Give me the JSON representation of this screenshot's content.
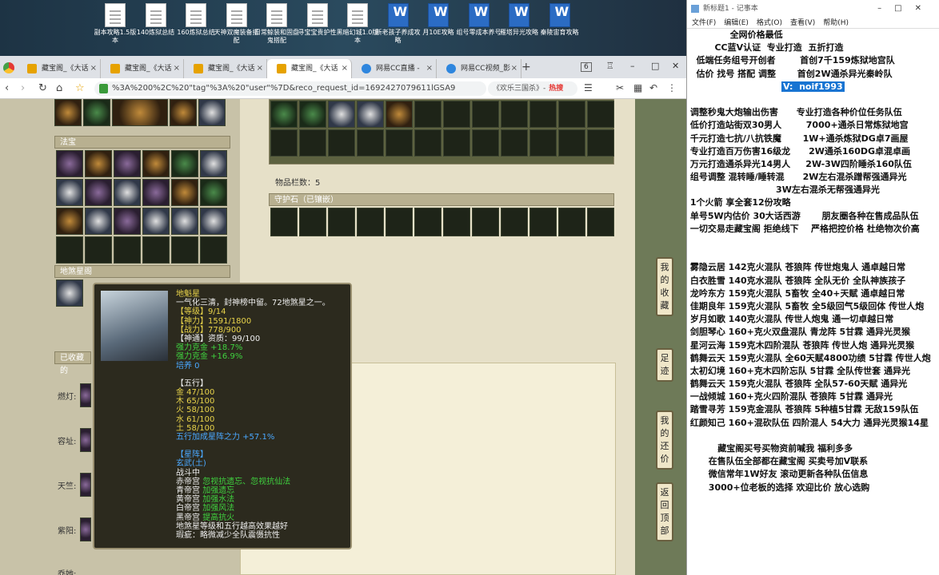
{
  "desktop": {
    "icons": [
      {
        "label": "副本攻略1.5版本",
        "type": "doc"
      },
      {
        "label": "140炼狱总结",
        "type": "doc"
      },
      {
        "label": "160炼狱总结",
        "type": "doc"
      },
      {
        "label": "天神双魔装备搭配",
        "type": "doc"
      },
      {
        "label": "日常鲸装和固盘鬼搭配",
        "type": "doc"
      },
      {
        "label": "寻宝宝贵护性",
        "type": "doc"
      },
      {
        "label": "黑暗幻城1.0版本",
        "type": "doc"
      },
      {
        "label": "新老孩子养成攻略",
        "type": "word"
      },
      {
        "label": "月10E攻略",
        "type": "word"
      },
      {
        "label": "组号零成本养号",
        "type": "word"
      },
      {
        "label": "雁塔异光攻略",
        "type": "word"
      },
      {
        "label": "秦陵宙育攻略",
        "type": "word"
      }
    ]
  },
  "browser": {
    "tabs": [
      {
        "label": "藏宝阁_《大话",
        "icon": "cbg"
      },
      {
        "label": "藏宝阁_《大话",
        "icon": "cbg"
      },
      {
        "label": "藏宝阁_《大话",
        "icon": "cbg"
      },
      {
        "label": "藏宝阁_《大话",
        "icon": "cbg",
        "active": true
      },
      {
        "label": "网易CC直播 -",
        "icon": "cc"
      },
      {
        "label": "网易CC视频_影",
        "icon": "cc"
      }
    ],
    "tab_count": "6",
    "url": "%3A%200%2C%20\"tag\"%3A%20\"user\"%7D&reco_request_id=1692427079611lGSA9",
    "search_text": "《欢乐三国杀》-",
    "search_hot": "热搜"
  },
  "page": {
    "section_fabao": "法宝",
    "section_disha": "地煞星阁",
    "section_collected": "已收藏的",
    "item_count": "物品栏数：5",
    "guardian_title": "守护石（已镶嵌）",
    "left_labels": [
      "燃灯:",
      "容址:",
      "天竺:",
      "紫阳:",
      "乔她:"
    ],
    "side_buttons": [
      {
        "label": "我的收藏"
      },
      {
        "label": "足迹"
      },
      {
        "label": "我的还价"
      },
      {
        "label": "返回顶部"
      }
    ]
  },
  "tooltip": {
    "name": "地魁星",
    "desc": "一气化三清，封神榜中留。72地煞星之一。",
    "level": "【等级】9/14",
    "power": "【神力】1591/1800",
    "battle": "【战力】778/900",
    "aptitude": "【神通】资质：99/100",
    "kezhi1": "强力克金 +18.7%",
    "kezhi2": "强力克金 +16.9%",
    "peiyang": "培养 0",
    "wuxing_title": "【五行】",
    "jin": "金 47/100",
    "mu": "木 65/100",
    "huo": "火 58/100",
    "shui": "水 61/100",
    "tu": "土 58/100",
    "wuxing_bonus": "五行加成星阵之力 +57.1%",
    "xingzhen_title": "【星阵】",
    "xingzhen_name": "玄武(土)",
    "status": "战斗中",
    "chidi_k": "赤帝宫",
    "chidi_v": "忽视抗遗忘、忽视抗仙法",
    "qingdi_k": "青帝宫",
    "qingdi_v": "加强遗忘",
    "huangdi_k": "黄帝宫",
    "huangdi_v": "加强水法",
    "baidi_k": "白帝宫",
    "baidi_v": "加强风法",
    "heidi_k": "黑帝宫",
    "heidi_v": "提高抗火",
    "footer1": "地煞星等级和五行越高效果越好",
    "footer2": "瑕疵：略微减少全队震慑抗性"
  },
  "notepad": {
    "title": "新标题1 - 记事本",
    "menu": [
      "文件(F)",
      "编辑(E)",
      "格式(O)",
      "查看(V)",
      "帮助(H)"
    ],
    "lines": [
      "              全网价格最低",
      "         CC蓝V认证  专业打造  五折打造",
      "   低端任务组号开创者        首创7千159炼狱地宫队",
      "   估价 找号 搭配 调整       首创2W通杀异光秦岭队",
      "",
      " 调整秒鬼大炮输出伤害      专业打造各种价位任务队伍",
      " 低价打造站街双30男人        7000+通杀日常炼狱地宫",
      " 千元打造七抗/八抗铁魔       1W+通杀炼狱DG卓7画屋",
      " 专业打造百万伤害16级龙      2W通杀160DG卓混卓画",
      " 万元打造通杀异光14男人     2W-3W四阶睡杀160队伍",
      " 组号调整 混转睡/睡转混      2W左右混杀蹭帮强通异光",
      "                             3W左右混杀无帮强通异光",
      " 1个火箭 享全套12份攻略",
      " 单号5W内估价 30大话西游       朋友圈各种在售成品队伍",
      " 一切交易走藏宝阁 拒绝线下    严格把控价格 杜绝物次价高",
      "",
      "",
      " 雾隐云居 142克火混队 苍狼阵 传世炮鬼人 通卓越日常",
      " 白衣胜雪 140克水混队 苍狼阵 全队无价 全队神族孩子",
      " 龙吟东方 159克火混队 5畜牧 全40+天赋 通卓越日常",
      " 佳期良年 159克火混队 5畜牧 全5级回气5级回体 传世人炮",
      " 岁月如歌 140克火混队 传世人炮鬼 通一切卓越日常",
      " 剑胆琴心 160+克火双盘混队 青龙阵 5甘霖 通异光灵猴",
      " 星河云海 159克木四阶混队 苍狼阵 传世人炮 通异光灵猴",
      " 鹤舞云天 159克火混队 全60天赋4800功绩 5甘霖 传世人炮",
      " 太初幻境 160+克木四阶忘队 5甘霖 全队传世套 通异光",
      " 鹤舞云天 159克火混队 苍狼阵 全队57-60天赋 通异光",
      " 一战倾城 160+克火四阶混队 苍狼阵 5甘霖 通异光",
      " 踏雪寻芳 159克金混队 苍狼阵 5种植5甘霖 无敌159队伍",
      " 红颜知己 160+混砍队伍 四阶混人 54大力 通异光灵猴14星",
      "",
      "          藏宝阁买号买物资前喊我 福利多多",
      "       在售队伍全部都在藏宝阁 买卖号加V联系",
      "       微信常年1W好友 滚动更新各种队伍信息",
      "       3000+位老板的选择 欢迎比价 放心选购"
    ],
    "vline": "V:  noif1993"
  }
}
